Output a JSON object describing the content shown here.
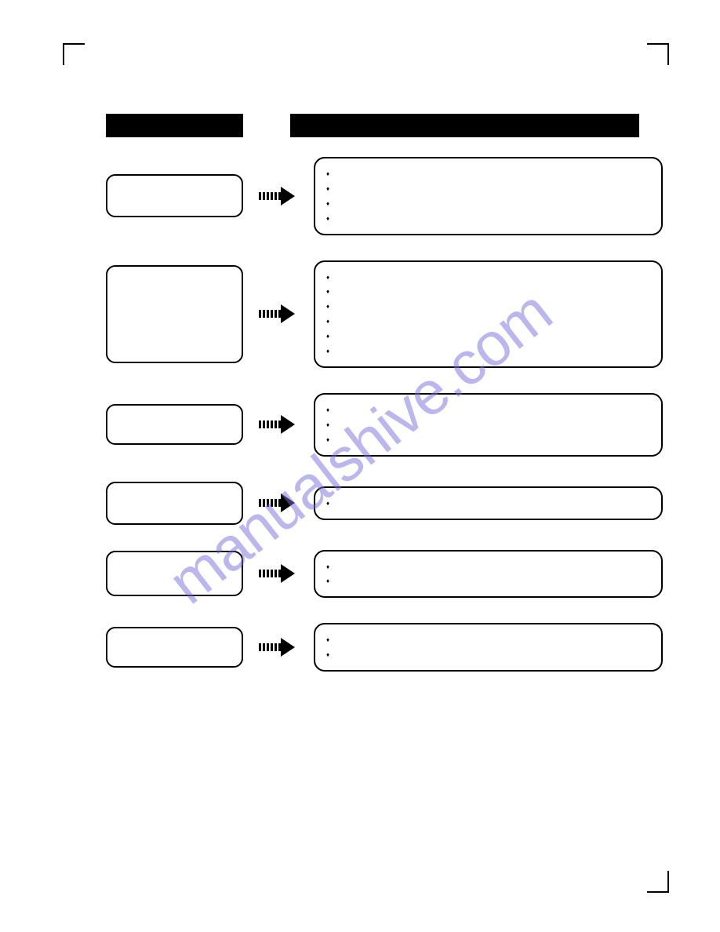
{
  "watermark": "manualshive.com",
  "headers": {
    "left": "",
    "right": ""
  },
  "rows": [
    {
      "left_height": "h1",
      "bullets": [
        "",
        "",
        "",
        ""
      ]
    },
    {
      "left_height": "h2",
      "bullets": [
        "",
        "",
        "",
        "",
        "",
        ""
      ]
    },
    {
      "left_height": "h3",
      "bullets": [
        "",
        "",
        ""
      ]
    },
    {
      "left_height": "h4",
      "bullets": [
        ""
      ]
    },
    {
      "left_height": "h5",
      "bullets": [
        "",
        ""
      ]
    },
    {
      "left_height": "h6",
      "bullets": [
        "",
        ""
      ]
    }
  ]
}
